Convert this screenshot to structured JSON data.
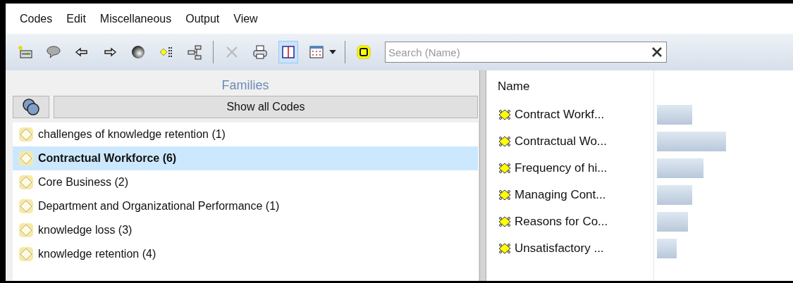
{
  "menu": [
    "Codes",
    "Edit",
    "Miscellaneous",
    "Output",
    "View"
  ],
  "toolbar": [
    {
      "kind": "button",
      "selected": false,
      "disabled": false
    },
    {
      "kind": "button",
      "selected": false,
      "disabled": false
    },
    {
      "kind": "button",
      "selected": false,
      "disabled": false
    },
    {
      "kind": "button",
      "selected": false,
      "disabled": false
    },
    {
      "kind": "button",
      "selected": false,
      "disabled": false
    },
    {
      "kind": "button",
      "selected": false,
      "disabled": false
    },
    {
      "kind": "button",
      "selected": false,
      "disabled": false
    },
    {
      "kind": "separator"
    },
    {
      "kind": "button",
      "selected": false,
      "disabled": true
    },
    {
      "kind": "button",
      "selected": false,
      "disabled": false
    },
    {
      "kind": "button",
      "selected": true,
      "disabled": false
    },
    {
      "kind": "button",
      "selected": false,
      "disabled": false
    },
    {
      "kind": "dropdown"
    },
    {
      "kind": "separator"
    },
    {
      "kind": "button",
      "selected": false,
      "disabled": false
    }
  ],
  "search": {
    "placeholder": "Search (Name)"
  },
  "families": {
    "title": "Families",
    "show_all": "Show all Codes",
    "items": [
      {
        "label": "challenges of knowledge retention (1)",
        "selected": false
      },
      {
        "label": "Contractual Workforce (6)",
        "selected": true
      },
      {
        "label": "Core Business (2)",
        "selected": false
      },
      {
        "label": "Department and Organizational Performance (1)",
        "selected": false
      },
      {
        "label": "knowledge loss (3)",
        "selected": false
      },
      {
        "label": "knowledge retention (4)",
        "selected": false
      }
    ]
  },
  "codes": {
    "columns": [
      "Name"
    ],
    "rows": [
      {
        "name": "Contract Workf..."
      },
      {
        "name": "Contractual Wo..."
      },
      {
        "name": "Frequency of hi..."
      },
      {
        "name": "Managing Cont..."
      },
      {
        "name": "Reasons for Co..."
      },
      {
        "name": "Unsatisfactory ..."
      }
    ]
  }
}
